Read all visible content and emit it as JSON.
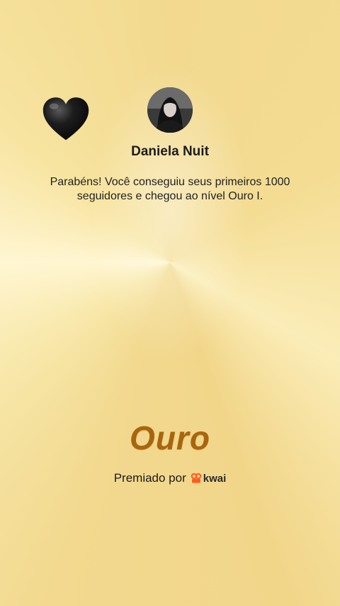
{
  "profile": {
    "name": "Daniela Nuit",
    "emoji_icon": "black-heart-icon"
  },
  "message": "Parabéns! Você conseguiu seus primeiros 1000 seguidores e chegou ao nível Ouro I.",
  "level": "Ouro",
  "footer": {
    "awarded_by": "Premiado por",
    "brand": "kwai",
    "brand_color": "#ff5a1f"
  },
  "colors": {
    "background": "#f2d98f",
    "level_text": "#a8650f"
  }
}
